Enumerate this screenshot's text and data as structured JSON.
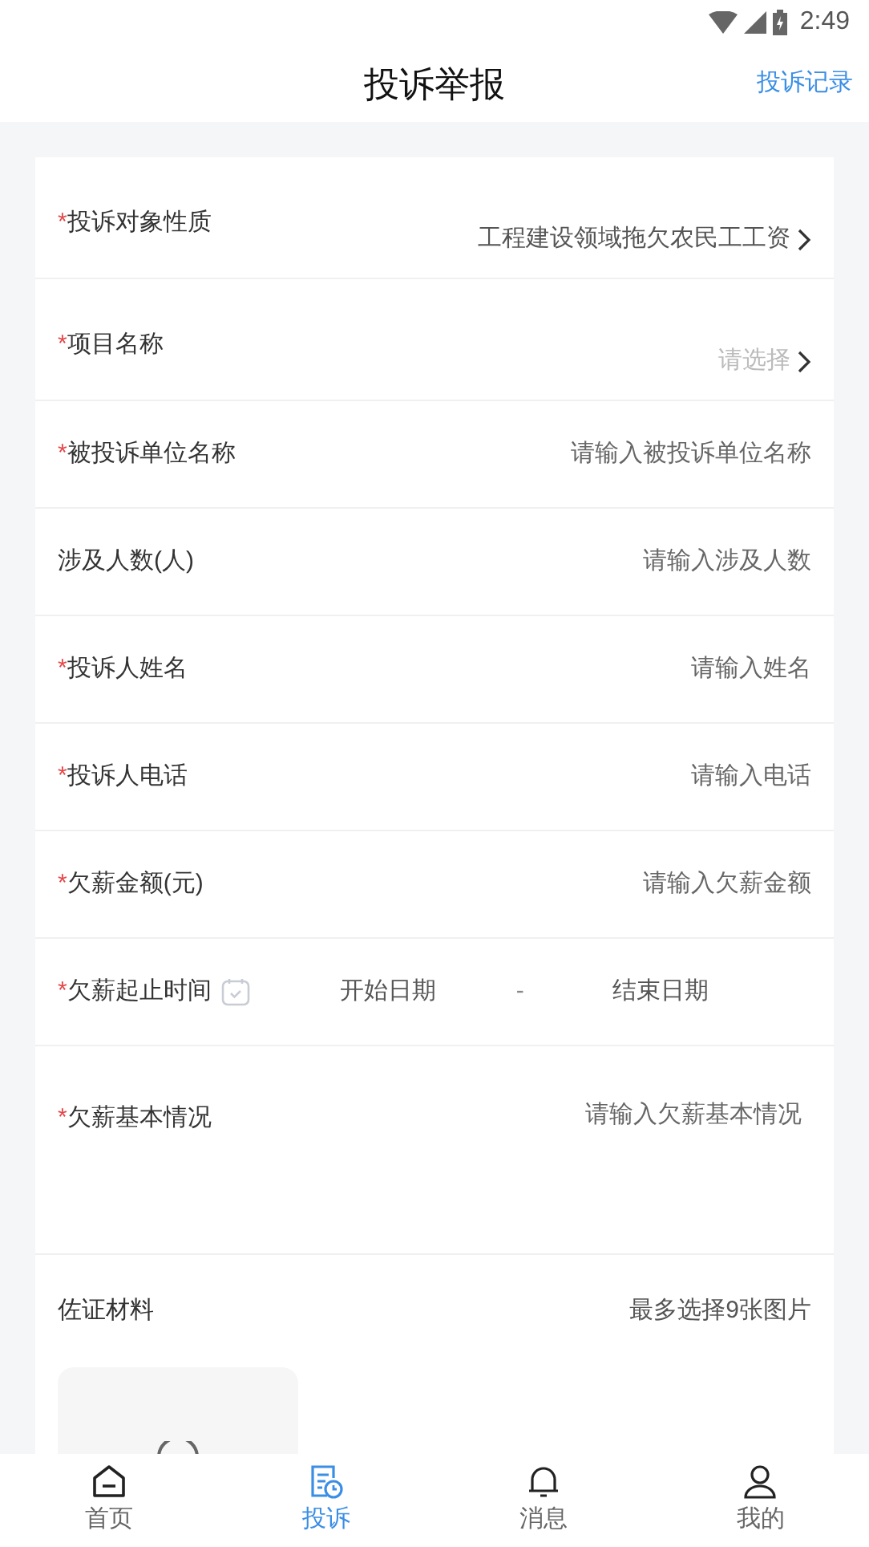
{
  "status_bar": {
    "time": "2:49"
  },
  "header": {
    "title": "投诉举报",
    "action": "投诉记录"
  },
  "fields": [
    {
      "kind": "select",
      "mark": "*",
      "label": "投诉对象性质",
      "value": "工程建设领域拖欠农民工工资"
    },
    {
      "kind": "select",
      "mark": "*",
      "label": "项目名称",
      "placeholder": "请选择"
    },
    {
      "kind": "input",
      "mark": "*",
      "label": "被投诉单位名称",
      "placeholder": "请输入被投诉单位名称"
    },
    {
      "kind": "input",
      "label": "涉及人数(人)",
      "placeholder": "请输入涉及人数"
    },
    {
      "kind": "input",
      "mark": "*",
      "label": "投诉人姓名",
      "placeholder": "请输入姓名"
    },
    {
      "kind": "input",
      "mark": "*",
      "label": "投诉人电话",
      "placeholder": "请输入电话"
    },
    {
      "kind": "input",
      "mark": "*",
      "label": "欠薪金额(元)",
      "placeholder": "请输入欠薪金额"
    },
    {
      "kind": "daterange",
      "mark": "*",
      "label": "欠薪起止时间",
      "start": "开始日期",
      "separator": "-",
      "end": "结束日期"
    },
    {
      "kind": "textarea",
      "mark": "*",
      "label": "欠薪基本情况",
      "placeholder": "请输入欠薪基本情况"
    }
  ],
  "evidence": {
    "label": "佐证材料",
    "hint": "最多选择9张图片"
  },
  "tabs": [
    {
      "kind": "home",
      "label": "首页",
      "selected": false
    },
    {
      "kind": "complaint",
      "label": "投诉",
      "selected": true
    },
    {
      "kind": "bell",
      "label": "消息",
      "selected": false
    },
    {
      "kind": "user",
      "label": "我的",
      "selected": false
    }
  ]
}
